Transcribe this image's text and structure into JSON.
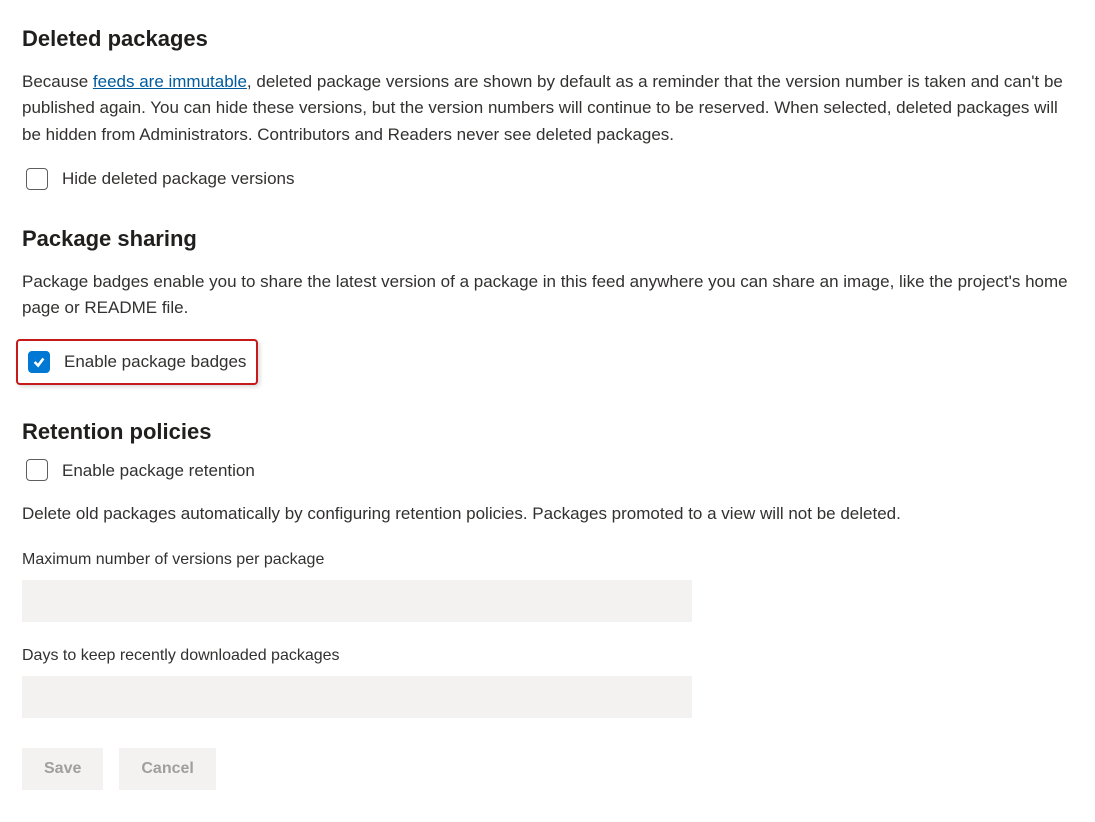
{
  "deleted": {
    "heading": "Deleted packages",
    "desc_prefix": "Because ",
    "link_text": "feeds are immutable",
    "desc_suffix": ", deleted package versions are shown by default as a reminder that the version number is taken and can't be published again. You can hide these versions, but the version numbers will continue to be reserved. When selected, deleted packages will be hidden from Administrators. Contributors and Readers never see deleted packages.",
    "checkbox_label": "Hide deleted package versions"
  },
  "sharing": {
    "heading": "Package sharing",
    "desc": "Package badges enable you to share the latest version of a package in this feed anywhere you can share an image, like the project's home page or README file.",
    "checkbox_label": "Enable package badges"
  },
  "retention": {
    "heading": "Retention policies",
    "checkbox_label": "Enable package retention",
    "desc": "Delete old packages automatically by configuring retention policies. Packages promoted to a view will not be deleted.",
    "max_versions_label": "Maximum number of versions per package",
    "days_label": "Days to keep recently downloaded packages"
  },
  "buttons": {
    "save": "Save",
    "cancel": "Cancel"
  }
}
